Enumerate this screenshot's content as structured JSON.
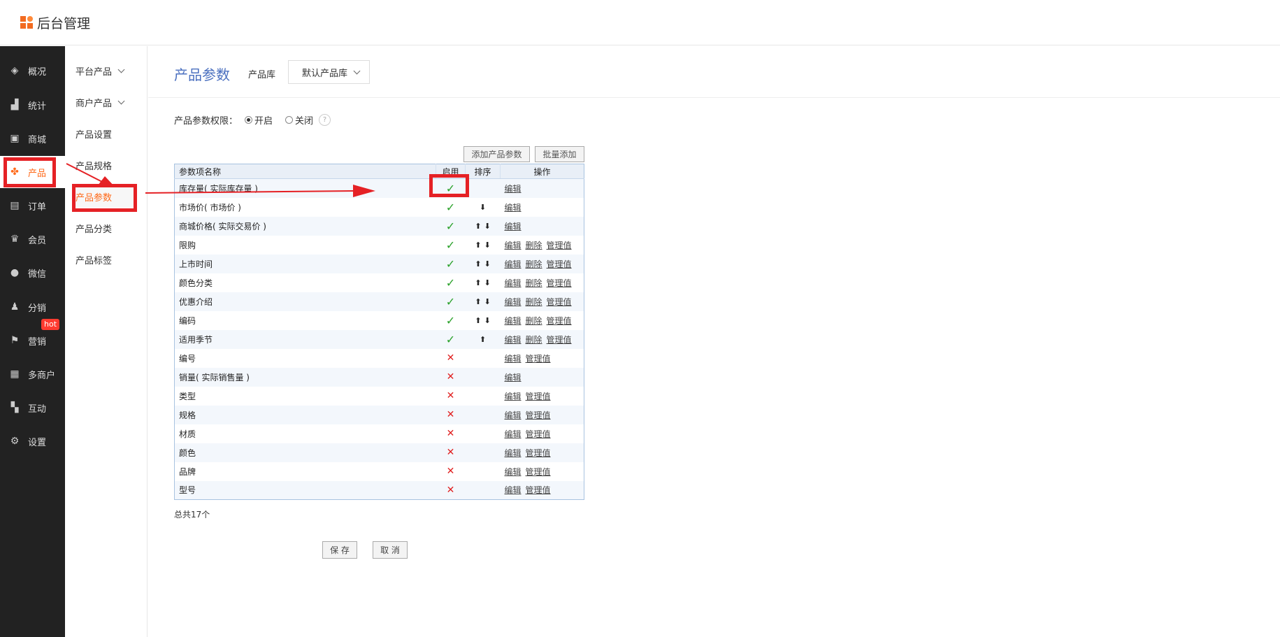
{
  "app": {
    "title": "后台管理"
  },
  "sidebar": {
    "items": [
      {
        "label": "概况",
        "icon": "layers-icon"
      },
      {
        "label": "统计",
        "icon": "chart-icon"
      },
      {
        "label": "商城",
        "icon": "shop-icon"
      },
      {
        "label": "产品",
        "icon": "grid-icon"
      },
      {
        "label": "订单",
        "icon": "order-icon"
      },
      {
        "label": "会员",
        "icon": "crown-icon"
      },
      {
        "label": "微信",
        "icon": "wechat-icon"
      },
      {
        "label": "分销",
        "icon": "user-icon"
      },
      {
        "label": "营销",
        "icon": "flag-icon"
      },
      {
        "label": "多商户",
        "icon": "multi-shop-icon"
      },
      {
        "label": "互动",
        "icon": "interact-icon"
      },
      {
        "label": "设置",
        "icon": "gear-icon"
      }
    ],
    "hot_badge": "hot"
  },
  "subnav": {
    "items": [
      {
        "label": "平台产品"
      },
      {
        "label": "商户产品"
      },
      {
        "label": "产品设置"
      },
      {
        "label": "产品规格"
      },
      {
        "label": "产品参数"
      },
      {
        "label": "产品分类"
      },
      {
        "label": "产品标签"
      }
    ]
  },
  "page": {
    "title": "产品参数",
    "lib_label": "产品库",
    "lib_value": "默认产品库",
    "perm_label": "产品参数权限：",
    "perm_on": "开启",
    "perm_off": "关闭",
    "help": "?",
    "add_btn": "添加产品参数",
    "batch_btn": "批量添加",
    "total": "总共17个",
    "save": "保 存",
    "cancel": "取 消"
  },
  "table": {
    "headers": [
      "参数项名称",
      "启用",
      "排序",
      "操作"
    ],
    "ops": {
      "edit": "编辑",
      "delete": "删除",
      "manage": "管理值"
    },
    "rows": [
      {
        "name": "库存量( 实际库存量 )",
        "enabled": true,
        "up": false,
        "down": false,
        "del": false,
        "manage": false
      },
      {
        "name": "市场价( 市场价 )",
        "enabled": true,
        "up": false,
        "down": true,
        "del": false,
        "manage": false
      },
      {
        "name": "商城价格( 实际交易价 )",
        "enabled": true,
        "up": true,
        "down": true,
        "del": false,
        "manage": false
      },
      {
        "name": "限购",
        "enabled": true,
        "up": true,
        "down": true,
        "del": true,
        "manage": true
      },
      {
        "name": "上市时间",
        "enabled": true,
        "up": true,
        "down": true,
        "del": true,
        "manage": true
      },
      {
        "name": "颜色分类",
        "enabled": true,
        "up": true,
        "down": true,
        "del": true,
        "manage": true
      },
      {
        "name": "优惠介绍",
        "enabled": true,
        "up": true,
        "down": true,
        "del": true,
        "manage": true
      },
      {
        "name": "编码",
        "enabled": true,
        "up": true,
        "down": true,
        "del": true,
        "manage": true
      },
      {
        "name": "适用季节",
        "enabled": true,
        "up": true,
        "down": false,
        "del": true,
        "manage": true
      },
      {
        "name": "编号",
        "enabled": false,
        "up": false,
        "down": false,
        "del": false,
        "manage": true
      },
      {
        "name": "销量( 实际销售量 )",
        "enabled": false,
        "up": false,
        "down": false,
        "del": false,
        "manage": false
      },
      {
        "name": "类型",
        "enabled": false,
        "up": false,
        "down": false,
        "del": false,
        "manage": true
      },
      {
        "name": "规格",
        "enabled": false,
        "up": false,
        "down": false,
        "del": false,
        "manage": true
      },
      {
        "name": "材质",
        "enabled": false,
        "up": false,
        "down": false,
        "del": false,
        "manage": true
      },
      {
        "name": "颜色",
        "enabled": false,
        "up": false,
        "down": false,
        "del": false,
        "manage": true
      },
      {
        "name": "品牌",
        "enabled": false,
        "up": false,
        "down": false,
        "del": false,
        "manage": true
      },
      {
        "name": "型号",
        "enabled": false,
        "up": false,
        "down": false,
        "del": false,
        "manage": true
      }
    ]
  },
  "colors": {
    "accent": "#ff6a1a",
    "title_blue": "#4a6fbf",
    "annotation_red": "#e52125",
    "check_green": "#2aa12a"
  }
}
